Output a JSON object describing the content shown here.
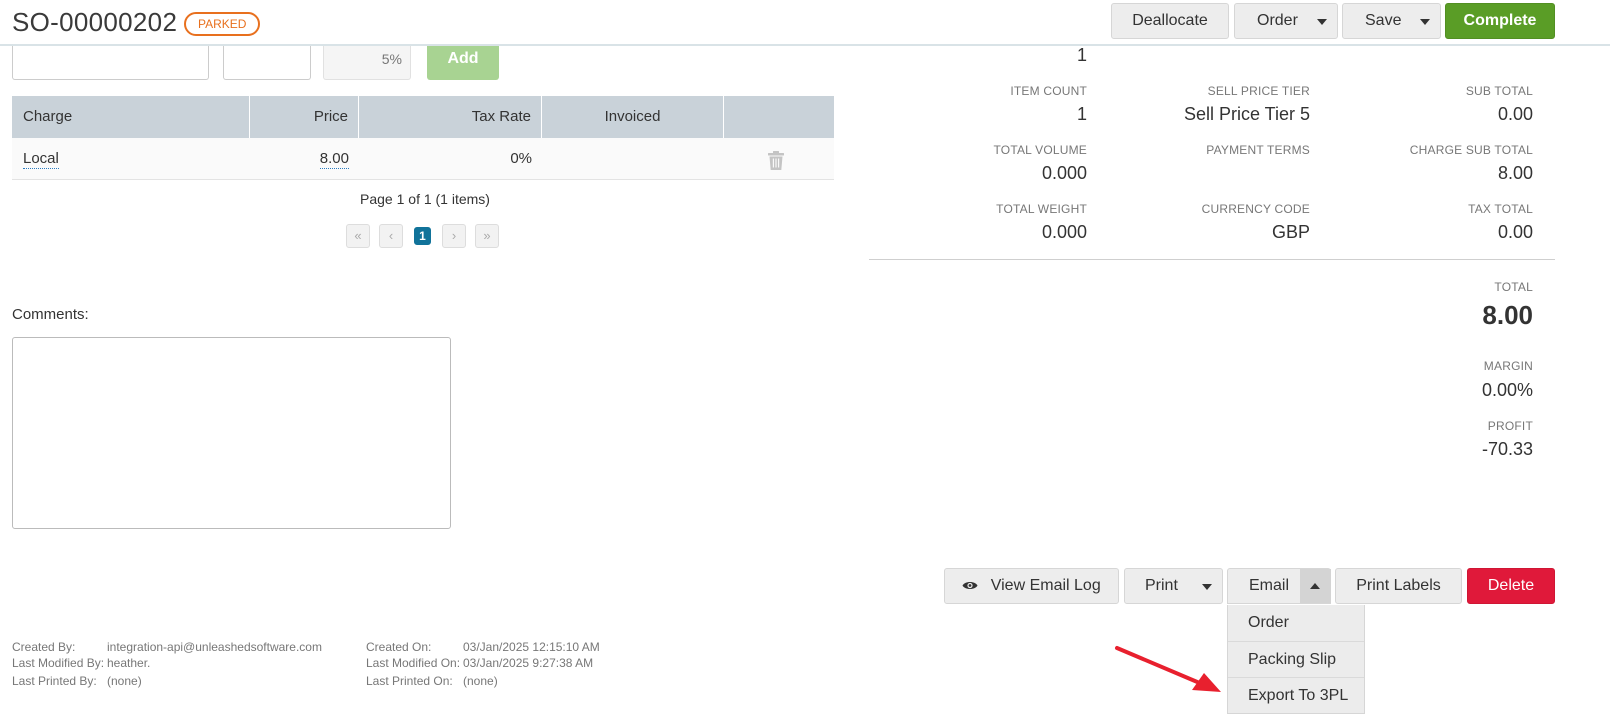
{
  "header": {
    "order_number": "SO-00000202",
    "status_badge": "PARKED",
    "buttons": {
      "deallocate": "Deallocate",
      "order": "Order",
      "save": "Save",
      "complete": "Complete"
    }
  },
  "charge_entry": {
    "tax_rate_display": "5%",
    "add_label": "Add"
  },
  "charges_table": {
    "columns": [
      "Charge",
      "Price",
      "Tax Rate",
      "Invoiced",
      ""
    ],
    "rows": [
      {
        "charge": "Local",
        "price": "8.00",
        "tax_rate": "0%",
        "invoiced": ""
      }
    ],
    "pager_text": "Page 1 of 1 (1 items)",
    "current_page": "1"
  },
  "comments": {
    "label": "Comments:",
    "value": ""
  },
  "summary": {
    "top_value": "1",
    "item_count": {
      "label": "ITEM COUNT",
      "value": "1"
    },
    "sell_price_tier": {
      "label": "SELL PRICE TIER",
      "value": "Sell Price Tier 5"
    },
    "sub_total": {
      "label": "SUB TOTAL",
      "value": "0.00"
    },
    "total_volume": {
      "label": "TOTAL VOLUME",
      "value": "0.000"
    },
    "payment_terms": {
      "label": "PAYMENT TERMS",
      "value": ""
    },
    "charge_sub_total": {
      "label": "CHARGE SUB TOTAL",
      "value": "8.00"
    },
    "total_weight": {
      "label": "TOTAL WEIGHT",
      "value": "0.000"
    },
    "currency_code": {
      "label": "CURRENCY CODE",
      "value": "GBP"
    },
    "tax_total": {
      "label": "TAX TOTAL",
      "value": "0.00"
    },
    "total": {
      "label": "TOTAL",
      "value": "8.00"
    },
    "margin": {
      "label": "MARGIN",
      "value": "0.00%"
    },
    "profit": {
      "label": "PROFIT",
      "value": "-70.33"
    }
  },
  "actions": {
    "view_email_log": "View Email Log",
    "print": "Print",
    "email": "Email",
    "print_labels": "Print Labels",
    "delete": "Delete",
    "email_menu": [
      "Order",
      "Packing Slip",
      "Export To 3PL"
    ]
  },
  "footer": {
    "created_by_label": "Created By:",
    "created_by": "integration-api@unleashedsoftware.com",
    "last_modified_by_label": "Last Modified By:",
    "last_modified_by": "heather.",
    "last_printed_by_label": "Last Printed By:",
    "last_printed_by": "(none)",
    "created_on_label": "Created On:",
    "created_on": "03/Jan/2025 12:15:10 AM",
    "last_modified_on_label": "Last Modified On:",
    "last_modified_on": "03/Jan/2025 9:27:38 AM",
    "last_printed_on_label": "Last Printed On:",
    "last_printed_on": "(none)"
  },
  "colors": {
    "complete": "#5a9d26",
    "delete": "#e0193a",
    "badge": "#e8701e",
    "table_header": "#c9d2d9",
    "pager_active": "#11739a",
    "annotation_arrow": "#e8202e"
  }
}
